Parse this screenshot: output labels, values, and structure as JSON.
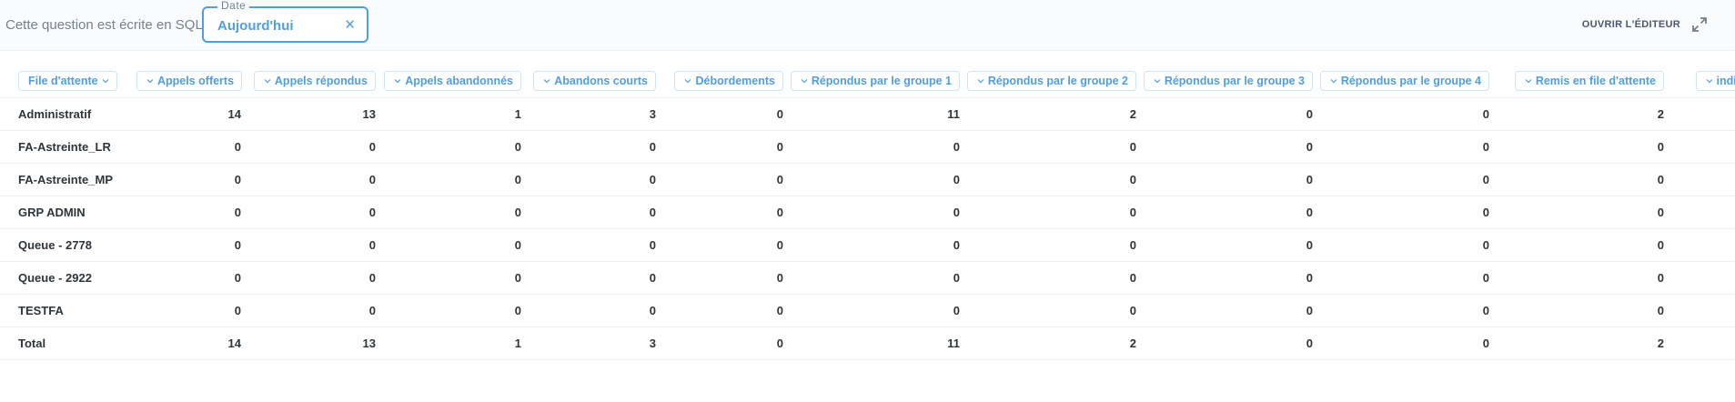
{
  "header": {
    "sql_note": "Cette question est écrite en SQL.",
    "date_filter": {
      "legend": "Date",
      "value": "Aujourd'hui",
      "clear_glyph": "✕"
    },
    "open_editor_label": "OUVRIR L'ÉDITEUR",
    "open_editor_icon": "expand-icon"
  },
  "table": {
    "columns": [
      "File d'attente",
      "Appels offerts",
      "Appels répondus",
      "Appels abandonnés",
      "Abandons courts",
      "Débordements",
      "Répondus par le groupe 1",
      "Répondus par le groupe 2",
      "Répondus par le groupe 3",
      "Répondus par le groupe 4",
      "Remis en file d'attente",
      "indispo"
    ],
    "rows": [
      [
        "Administratif",
        "14",
        "13",
        "1",
        "3",
        "0",
        "11",
        "2",
        "0",
        "0",
        "2",
        ""
      ],
      [
        "FA-Astreinte_LR",
        "0",
        "0",
        "0",
        "0",
        "0",
        "0",
        "0",
        "0",
        "0",
        "0",
        ""
      ],
      [
        "FA-Astreinte_MP",
        "0",
        "0",
        "0",
        "0",
        "0",
        "0",
        "0",
        "0",
        "0",
        "0",
        ""
      ],
      [
        "GRP ADMIN",
        "0",
        "0",
        "0",
        "0",
        "0",
        "0",
        "0",
        "0",
        "0",
        "0",
        ""
      ],
      [
        "Queue - 2778",
        "0",
        "0",
        "0",
        "0",
        "0",
        "0",
        "0",
        "0",
        "0",
        "0",
        ""
      ],
      [
        "Queue - 2922",
        "0",
        "0",
        "0",
        "0",
        "0",
        "0",
        "0",
        "0",
        "0",
        "0",
        ""
      ],
      [
        "TESTFA",
        "0",
        "0",
        "0",
        "0",
        "0",
        "0",
        "0",
        "0",
        "0",
        "0",
        ""
      ],
      [
        "Total",
        "14",
        "13",
        "1",
        "3",
        "0",
        "11",
        "2",
        "0",
        "0",
        "2",
        ""
      ]
    ]
  },
  "colors": {
    "accent": "#509ee3",
    "text": "#2e353b",
    "muted": "#74838f"
  }
}
